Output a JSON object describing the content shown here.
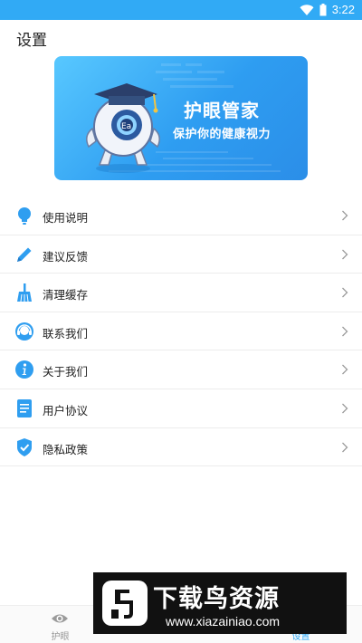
{
  "status_bar": {
    "time": "3:22",
    "icons": [
      "wifi-icon",
      "battery-icon"
    ]
  },
  "page": {
    "title": "设置"
  },
  "banner": {
    "title": "护眼管家",
    "subtitle": "保护你的健康视力",
    "mascot_badge": "Ea"
  },
  "menu": {
    "items": [
      {
        "label": "使用说明",
        "icon": "lightbulb-icon"
      },
      {
        "label": "建议反馈",
        "icon": "pencil-icon"
      },
      {
        "label": "清理缓存",
        "icon": "broom-icon"
      },
      {
        "label": "联系我们",
        "icon": "headset-icon"
      },
      {
        "label": "关于我们",
        "icon": "info-icon"
      },
      {
        "label": "用户协议",
        "icon": "document-icon"
      },
      {
        "label": "隐私政策",
        "icon": "shield-check-icon"
      }
    ]
  },
  "tab_bar": {
    "tabs": [
      {
        "label": "护眼"
      },
      {
        "label": ""
      },
      {
        "label": "设置"
      }
    ],
    "active_index": 2
  },
  "watermark": {
    "title": "下载鸟资源",
    "url": "www.xiazainiao.com"
  },
  "colors": {
    "accent": "#31aaf5",
    "banner_dark": "#2b8ee8",
    "icon_blue": "#2f9ef0"
  }
}
